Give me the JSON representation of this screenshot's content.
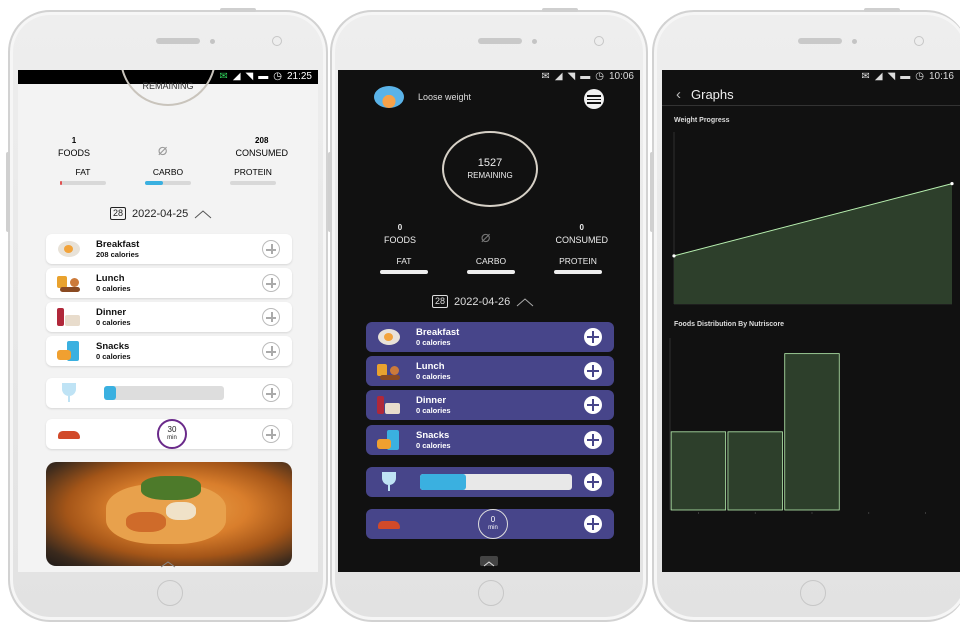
{
  "colors": {
    "accent_blue": "#3ab0e0",
    "purple": "#47458a",
    "dark_bg": "#111111",
    "chart_fill": "#2d3f2b",
    "chart_line": "#b8f0b0"
  },
  "screen1": {
    "status": {
      "time": "21:25"
    },
    "remaining_label": "REMAINING",
    "foods_count": "1",
    "foods_label": "FOODS",
    "consumed_value": "208",
    "consumed_label": "CONSUMED",
    "macros": [
      {
        "label": "FAT",
        "fill": 0.05
      },
      {
        "label": "CARBO",
        "fill": 0.4
      },
      {
        "label": "PROTEIN",
        "fill": 0
      }
    ],
    "calendar_icon_text": "28",
    "date": "2022-04-25",
    "meals": [
      {
        "name": "Breakfast",
        "calories": "208 calories",
        "icon": "breakfast-icon"
      },
      {
        "name": "Lunch",
        "calories": "0 calories",
        "icon": "lunch-icon"
      },
      {
        "name": "Dinner",
        "calories": "0 calories",
        "icon": "dinner-icon"
      },
      {
        "name": "Snacks",
        "calories": "0 calories",
        "icon": "snacks-icon"
      }
    ],
    "water_progress": 0.1,
    "exercise_minutes": "30",
    "exercise_unit": "min"
  },
  "screen2": {
    "status": {
      "time": "10:06"
    },
    "goal": "Loose weight",
    "remaining_value": "1527",
    "remaining_label": "REMAINING",
    "foods_count": "0",
    "foods_label": "FOODS",
    "consumed_value": "0",
    "consumed_label": "CONSUMED",
    "macros": [
      {
        "label": "FAT",
        "fill": 0
      },
      {
        "label": "CARBO",
        "fill": 0
      },
      {
        "label": "PROTEIN",
        "fill": 0
      }
    ],
    "calendar_icon_text": "28",
    "date": "2022-04-26",
    "meals": [
      {
        "name": "Breakfast",
        "calories": "0 calories",
        "icon": "breakfast-icon"
      },
      {
        "name": "Lunch",
        "calories": "0 calories",
        "icon": "lunch-icon"
      },
      {
        "name": "Dinner",
        "calories": "0 calories",
        "icon": "dinner-icon"
      },
      {
        "name": "Snacks",
        "calories": "0 calories",
        "icon": "snacks-icon"
      }
    ],
    "water_progress": 0.3,
    "exercise_minutes": "0",
    "exercise_unit": "min"
  },
  "screen3": {
    "status": {
      "time": "10:16"
    },
    "back_glyph": "‹",
    "title": "Graphs",
    "chart_data": [
      {
        "type": "area",
        "title": "Weight Progress",
        "x": [
          0,
          1
        ],
        "y": [
          0.28,
          0.7
        ],
        "ylim": [
          0,
          1
        ]
      },
      {
        "type": "bar",
        "title": "Foods Distribution By Nutriscore",
        "categories": [
          "",
          "",
          "",
          "",
          ""
        ],
        "values": [
          1,
          1,
          2,
          0,
          0
        ],
        "ylim": [
          0,
          2.2
        ]
      }
    ]
  }
}
